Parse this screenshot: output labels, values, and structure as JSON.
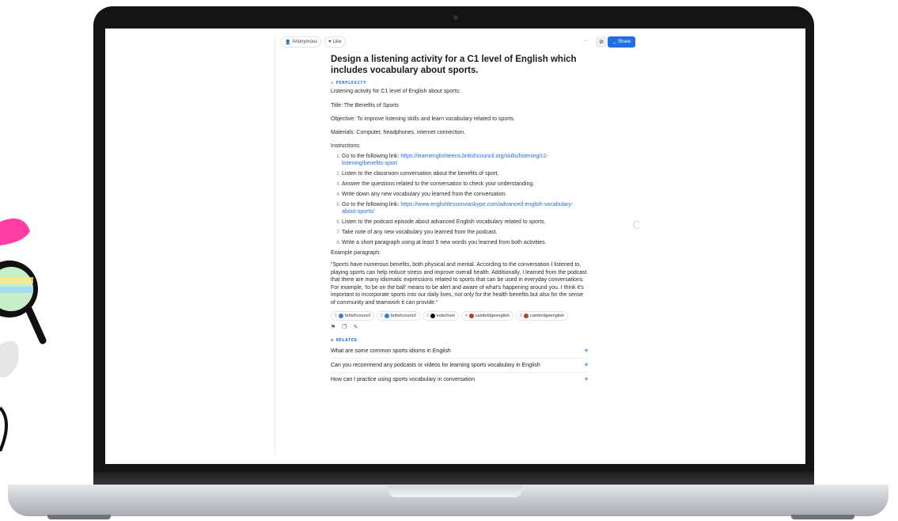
{
  "header": {
    "anonymous_label": "Anonymous",
    "like_label": "Like",
    "more_label": "···",
    "share_label": "Share"
  },
  "thread": {
    "question": "Design a listening activity for a C1 level of English which includes vocabulary about sports.",
    "source_label": "PERPLEXITY",
    "intro": "Listening activity for C1 level of English about sports:",
    "title_line": "Title: The Benefits of Sports",
    "objective": "Objective: To improve listening skills and learn vocabulary related to sports.",
    "materials": "Materials: Computer, headphones, internet connection.",
    "instructions_label": "Instructions:",
    "steps": [
      {
        "text": "Go to the following link: ",
        "link": "https://learnenglishteens.britishcouncil.org/skills/listening/c1-listening/benefits-sport"
      },
      {
        "text": "Listen to the classroom conversation about the benefits of sport.",
        "link": ""
      },
      {
        "text": "Answer the questions related to the conversation to check your understanding.",
        "link": ""
      },
      {
        "text": "Write down any new vocabulary you learned from the conversation.",
        "link": ""
      },
      {
        "text": "Go to the following link: ",
        "link": "https://www.englishlessonviaskype.com/advanced-english-vocabulary-about-sports/"
      },
      {
        "text": "Listen to the podcast episode about advanced English vocabulary related to sports.",
        "link": ""
      },
      {
        "text": "Take note of any new vocabulary you learned from the podcast.",
        "link": ""
      },
      {
        "text": "Write a short paragraph using at least 5 new words you learned from both activities.",
        "link": ""
      }
    ],
    "example_label": "Example paragraph:",
    "example_paragraph": "\"Sports have numerous benefits, both physical and mental. According to the conversation I listened to, playing sports can help reduce stress and improve overall health. Additionally, I learned from the podcast that there are many idiomatic expressions related to sports that can be used in everyday conversations. For example, 'to be on the ball' means to be alert and aware of what's happening around you. I think it's important to incorporate sports into our daily lives, not only for the health benefits but also for the sense of community and teamwork it can provide.\"",
    "sources": [
      {
        "num": "1",
        "name": "britishcouncil",
        "color": "#3d7bd9"
      },
      {
        "num": "2",
        "name": "britishcouncil",
        "color": "#3d7bd9"
      },
      {
        "num": "3",
        "name": "eslschool",
        "color": "#111111"
      },
      {
        "num": "4",
        "name": "cambridgeenglish",
        "color": "#c0392b"
      },
      {
        "num": "5",
        "name": "cambridgeenglish",
        "color": "#c0392b"
      }
    ],
    "related_label": "RELATED",
    "related": [
      "What are some common sports idioms in English",
      "Can you recommend any podcasts or videos for learning sports vocabulary in English",
      "How can I practice using sports vocabulary in conversation"
    ]
  },
  "colors": {
    "accent": "#1f6fe0",
    "deco_pink": "#ff3ea5"
  }
}
